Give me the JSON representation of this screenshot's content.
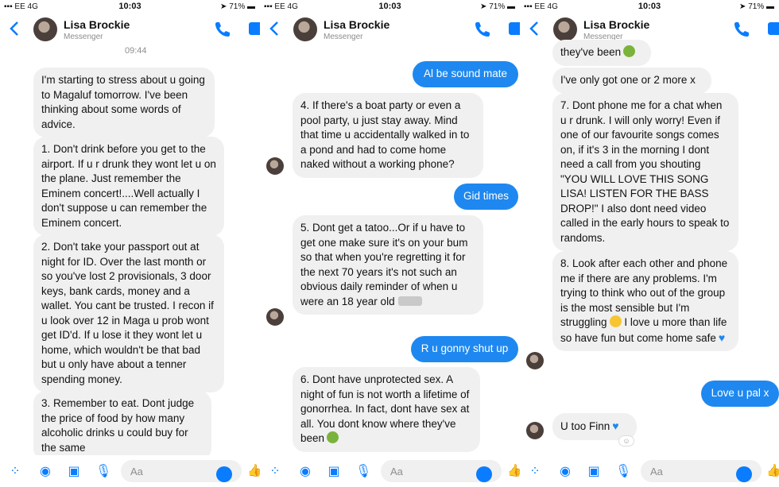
{
  "panels": [
    {
      "status": {
        "carrier": "EE",
        "network": "4G",
        "time": "10:03",
        "battery": "71%"
      },
      "header": {
        "name": "Lisa Brockie",
        "subtitle": "Messenger"
      },
      "timestamp": "09:44",
      "messages": [
        {
          "side": "in",
          "text": "I'm starting to stress about u going to Magaluf tomorrow. I've been thinking about some words of advice."
        },
        {
          "side": "in",
          "text": "1. Don't drink before you get to the airport. If u r drunk they wont let u on the plane. Just remember the Eminem concert!....Well actually I don't suppose u can remember the Eminem concert."
        },
        {
          "side": "in",
          "text": "2. Don't take your passport out at night for ID. Over the last month or so you've lost 2 provisionals, 3 door keys, bank cards, money and a wallet. You cant be trusted. I recon if u look over 12 in Maga u prob wont get ID'd. If u lose it they wont let u home, which wouldn't be that bad but u only have about a tenner spending money."
        },
        {
          "side": "in",
          "text": "3. Remember to eat. Dont judge the price of food by how many alcoholic drinks u could buy for the same"
        }
      ],
      "composer": {
        "placeholder": "Aa"
      }
    },
    {
      "status": {
        "carrier": "EE",
        "network": "4G",
        "time": "10:03",
        "battery": "71%"
      },
      "header": {
        "name": "Lisa Brockie",
        "subtitle": "Messenger"
      },
      "messages": [
        {
          "side": "out",
          "text": "Al be sound mate"
        },
        {
          "side": "in",
          "text": "4. If there's a boat party or even a pool party, u just stay away. Mind that time u accidentally walked in to a pond and had to come home naked without a working phone?"
        },
        {
          "side": "out",
          "text": "Gid times"
        },
        {
          "side": "in",
          "text": "5. Dont get a tatoo...Or if u have to get one make sure it's on your bum so that when you're regretting it for the next 70 years it's not such an obvious daily reminder of when u were an 18 year old"
        },
        {
          "side": "out",
          "text": "R u gonny shut up"
        },
        {
          "side": "in",
          "text": "6. Dont have unprotected sex. A night of fun is not worth a lifetime of gonorrhea. In fact, dont have sex at all. You dont know where they've been"
        }
      ],
      "composer": {
        "placeholder": "Aa"
      }
    },
    {
      "status": {
        "carrier": "EE",
        "network": "4G",
        "time": "10:03",
        "battery": "71%"
      },
      "header": {
        "name": "Lisa Brockie",
        "subtitle": "Messenger"
      },
      "messages": [
        {
          "side": "in",
          "text": "they've been"
        },
        {
          "side": "in",
          "text": "I've only got one or 2 more x"
        },
        {
          "side": "in",
          "text": "7. Dont phone me for a chat when u r drunk. I will only worry! Even if one of our favourite songs comes on, if it's 3 in the morning I dont need a call from you shouting \"YOU WILL LOVE THIS SONG LISA! LISTEN FOR THE BASS DROP!\" I also dont need video called in the early hours to speak to randoms."
        },
        {
          "side": "in",
          "text": "8. Look after each other and phone me if there are any problems. I'm trying to think who out of the group is the most sensible but I'm struggling"
        },
        {
          "side": "in",
          "text": "I love u more than life so have fun but come home safe"
        },
        {
          "side": "out",
          "text": "Love u pal x"
        },
        {
          "side": "in",
          "text": "U too Finn"
        }
      ],
      "composer": {
        "placeholder": "Aa"
      }
    }
  ],
  "icons": {
    "back": "chevron-left-icon",
    "call": "phone-icon",
    "video": "video-camera-icon",
    "apps": "grid-icon",
    "camera": "camera-icon",
    "gallery": "image-icon",
    "mic": "microphone-icon",
    "emoji": "smiley-icon",
    "like": "thumbs-up-icon"
  },
  "colors": {
    "accent": "#0a7cff",
    "outgoing": "#1e88f0",
    "incoming": "#f0f0f0"
  }
}
